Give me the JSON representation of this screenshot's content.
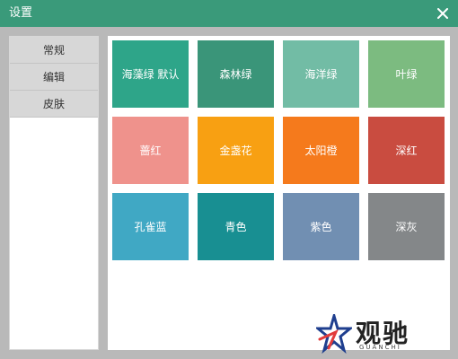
{
  "window": {
    "title": "设置"
  },
  "sidebar": {
    "items": [
      {
        "label": "常规"
      },
      {
        "label": "编辑"
      },
      {
        "label": "皮肤"
      }
    ]
  },
  "skins": [
    {
      "label": "海藻绿 默认",
      "color": "#2ea589"
    },
    {
      "label": "森林绿",
      "color": "#3a9579"
    },
    {
      "label": "海洋绿",
      "color": "#72bca5"
    },
    {
      "label": "叶绿",
      "color": "#7cbb80"
    },
    {
      "label": "蔷红",
      "color": "#ef928c"
    },
    {
      "label": "金盏花",
      "color": "#f8a012"
    },
    {
      "label": "太阳橙",
      "color": "#f57a1c"
    },
    {
      "label": "深红",
      "color": "#c94c40"
    },
    {
      "label": "孔雀蓝",
      "color": "#40a8c4"
    },
    {
      "label": "青色",
      "color": "#188f92"
    },
    {
      "label": "紫色",
      "color": "#718fb2"
    },
    {
      "label": "深灰",
      "color": "#848789"
    }
  ],
  "watermark": {
    "text": "观驰",
    "subtext": "GUANCHI"
  }
}
